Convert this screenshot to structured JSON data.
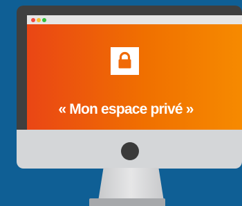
{
  "screen": {
    "title": "« Mon espace privé »",
    "icon": "lock-icon",
    "window_controls": [
      "close-dot",
      "minimize-dot",
      "maximize-dot"
    ]
  },
  "colors": {
    "background": "#0f5f95",
    "screen_gradient_start": "#ea4615",
    "screen_gradient_end": "#f68a00",
    "bezel": "#3f3f3f",
    "chin": "#d4d6d8"
  }
}
